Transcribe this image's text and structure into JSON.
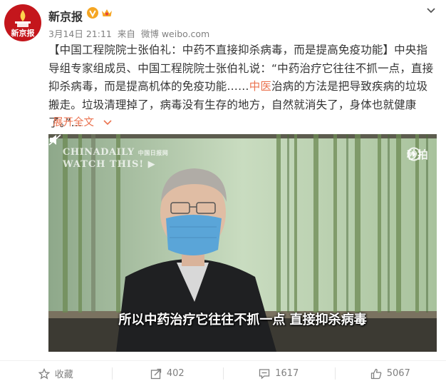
{
  "author": {
    "name": "新京报",
    "avatar_text": "新京报",
    "verified": true
  },
  "meta": {
    "date": "3月14日 21:11",
    "source_prefix": "来自",
    "source": "微博 weibo.com"
  },
  "post": {
    "text_before": "【中国工程院院士张伯礼：中药不直接抑杀病毒，而是提高免疫功能】中央指导组专家组成员、中国工程院院士张伯礼说：“中药治疗它往往不抓一点，直接抑杀病毒，而是提高机体的免疫功能……",
    "highlight": "中医",
    "text_after": "治病的方法是把导致疾病的垃圾搬走。垃圾清理掉了，病毒没有生存的地方，自然就消失了，身体也就健康了。”",
    "ellipsis": "...",
    "expand_label": "展开全文"
  },
  "video": {
    "watermark_brand": "CHINADAILY",
    "watermark_cn": "中国日报网",
    "watermark_tag": "WATCH THIS!",
    "platform": "秒拍",
    "subtitle": "所以中药治疗它往往不抓一点 直接抑杀病毒"
  },
  "actions": {
    "favorite_label": "收藏",
    "share_count": "402",
    "comment_count": "1617",
    "like_count": "5067"
  },
  "colors": {
    "accent": "#eb7350",
    "avatar_red": "#c4161c",
    "verified_orange": "#f5a623"
  }
}
